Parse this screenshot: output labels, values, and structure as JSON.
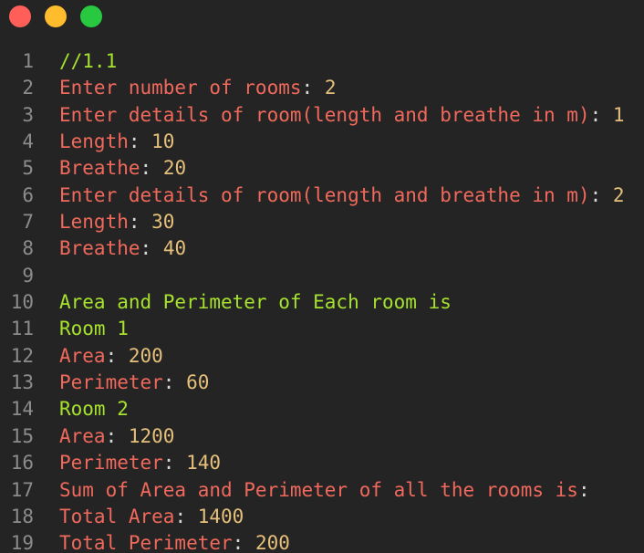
{
  "window": {
    "buttons": [
      "close",
      "minimize",
      "zoom"
    ]
  },
  "colors": {
    "background": "#242424",
    "line_number": "#8c8c8c",
    "green": "#a6e22e",
    "red": "#f0695c",
    "yellow": "#e6c07b",
    "punct": "#d8d8d8"
  },
  "lines": [
    {
      "n": "1",
      "parts": [
        {
          "t": "//1.1",
          "c": "green"
        }
      ]
    },
    {
      "n": "2",
      "parts": [
        {
          "t": "Enter number of rooms",
          "c": "red"
        },
        {
          "t": ": ",
          "c": "punct"
        },
        {
          "t": "2",
          "c": "yellow"
        }
      ]
    },
    {
      "n": "3",
      "parts": [
        {
          "t": "Enter details of room(length and breathe in m)",
          "c": "red"
        },
        {
          "t": ": ",
          "c": "punct"
        },
        {
          "t": "1",
          "c": "yellow"
        }
      ]
    },
    {
      "n": "4",
      "parts": [
        {
          "t": "Length",
          "c": "red"
        },
        {
          "t": ": ",
          "c": "punct"
        },
        {
          "t": "10",
          "c": "yellow"
        }
      ]
    },
    {
      "n": "5",
      "parts": [
        {
          "t": "Breathe",
          "c": "red"
        },
        {
          "t": ": ",
          "c": "punct"
        },
        {
          "t": "20",
          "c": "yellow"
        }
      ]
    },
    {
      "n": "6",
      "parts": [
        {
          "t": "Enter details of room(length and breathe in m)",
          "c": "red"
        },
        {
          "t": ": ",
          "c": "punct"
        },
        {
          "t": "2",
          "c": "yellow"
        }
      ]
    },
    {
      "n": "7",
      "parts": [
        {
          "t": "Length",
          "c": "red"
        },
        {
          "t": ": ",
          "c": "punct"
        },
        {
          "t": "30",
          "c": "yellow"
        }
      ]
    },
    {
      "n": "8",
      "parts": [
        {
          "t": "Breathe",
          "c": "red"
        },
        {
          "t": ": ",
          "c": "punct"
        },
        {
          "t": "40",
          "c": "yellow"
        }
      ]
    },
    {
      "n": "9",
      "parts": []
    },
    {
      "n": "10",
      "parts": [
        {
          "t": "Area and Perimeter of Each room is",
          "c": "green"
        }
      ]
    },
    {
      "n": "11",
      "parts": [
        {
          "t": "Room 1",
          "c": "green"
        }
      ]
    },
    {
      "n": "12",
      "parts": [
        {
          "t": "Area",
          "c": "red"
        },
        {
          "t": ": ",
          "c": "punct"
        },
        {
          "t": "200",
          "c": "yellow"
        }
      ]
    },
    {
      "n": "13",
      "parts": [
        {
          "t": "Perimeter",
          "c": "red"
        },
        {
          "t": ": ",
          "c": "punct"
        },
        {
          "t": "60",
          "c": "yellow"
        }
      ]
    },
    {
      "n": "14",
      "parts": [
        {
          "t": "Room 2",
          "c": "green"
        }
      ]
    },
    {
      "n": "15",
      "parts": [
        {
          "t": "Area",
          "c": "red"
        },
        {
          "t": ": ",
          "c": "punct"
        },
        {
          "t": "1200",
          "c": "yellow"
        }
      ]
    },
    {
      "n": "16",
      "parts": [
        {
          "t": "Perimeter",
          "c": "red"
        },
        {
          "t": ": ",
          "c": "punct"
        },
        {
          "t": "140",
          "c": "yellow"
        }
      ]
    },
    {
      "n": "17",
      "parts": [
        {
          "t": "Sum of Area and Perimeter of all the rooms is",
          "c": "red"
        },
        {
          "t": ":",
          "c": "punct"
        }
      ]
    },
    {
      "n": "18",
      "parts": [
        {
          "t": "Total Area",
          "c": "red"
        },
        {
          "t": ": ",
          "c": "punct"
        },
        {
          "t": "1400",
          "c": "yellow"
        }
      ]
    },
    {
      "n": "19",
      "parts": [
        {
          "t": "Total Perimeter",
          "c": "red"
        },
        {
          "t": ": ",
          "c": "punct"
        },
        {
          "t": "200",
          "c": "yellow"
        }
      ]
    }
  ]
}
